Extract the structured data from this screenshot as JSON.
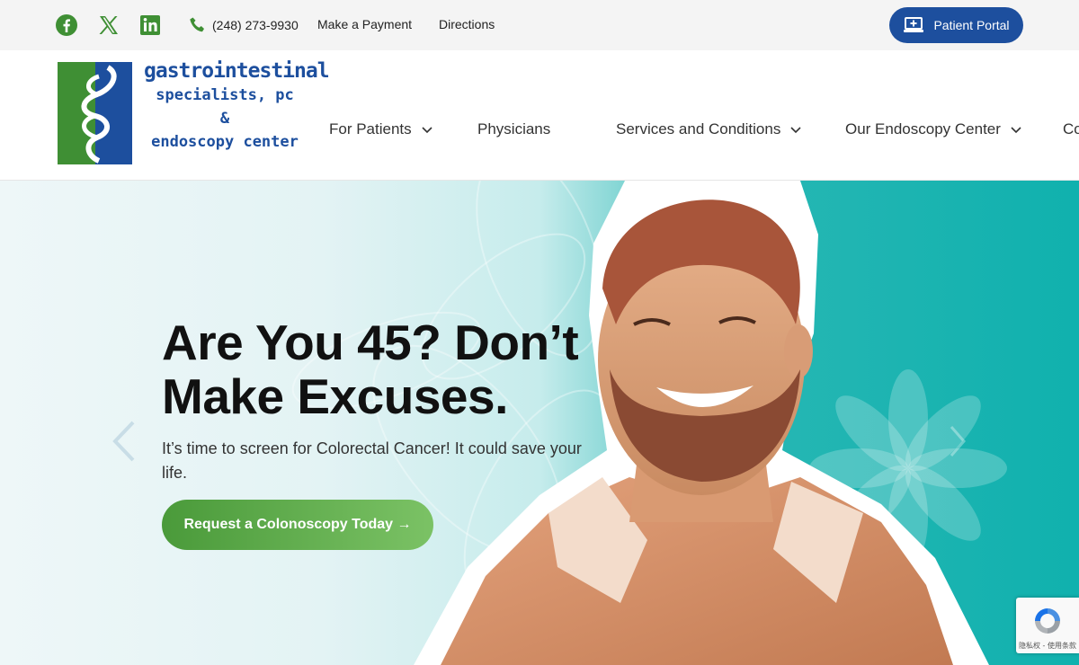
{
  "topbar": {
    "social": [
      {
        "name": "facebook-icon"
      },
      {
        "name": "x-twitter-icon"
      },
      {
        "name": "linkedin-icon"
      }
    ],
    "phone": "(248) 273-9930",
    "make_payment": "Make a Payment",
    "directions": "Directions",
    "patient_portal": "Patient Portal"
  },
  "logo": {
    "line1": "gastrointestinal",
    "line2": "specialists, pc",
    "line3": "&",
    "line4": "endoscopy center"
  },
  "nav": {
    "items": [
      {
        "label": "For Patients",
        "has_dropdown": true
      },
      {
        "label": "Physicians",
        "has_dropdown": false
      },
      {
        "label": "Services and Conditions",
        "has_dropdown": true
      },
      {
        "label": "Our Endoscopy Center",
        "has_dropdown": true
      },
      {
        "label": "Co",
        "has_dropdown": false
      }
    ]
  },
  "hero": {
    "title_line1": "Are You 45? Don’t",
    "title_line2": "Make Excuses.",
    "subtitle": "It’s time to screen for Colorectal Cancer! It could save your life.",
    "cta": "Request a Colonoscopy Today →"
  },
  "recaptcha": {
    "text": "隐私权 - 使用条款"
  },
  "colors": {
    "brand_blue": "#1d4f9e",
    "brand_green": "#3f8f34",
    "teal": "#10b1ae",
    "cta_start": "#4a9a3a",
    "cta_end": "#7bc265"
  }
}
